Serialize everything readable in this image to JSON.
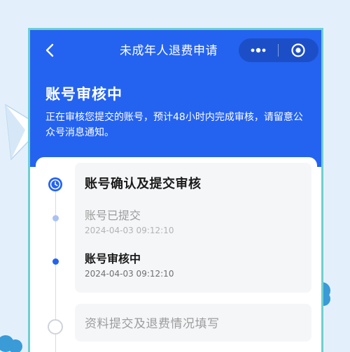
{
  "nav": {
    "title": "未成年人退费申请",
    "back_icon": "chevron-left-icon",
    "more_icon": "more-dots-icon",
    "close_icon": "target-circle-icon"
  },
  "header": {
    "title": "账号审核中",
    "description": "正在审核您提交的账号，预计48小时内完成审核，请留意公众号消息通知。"
  },
  "steps": [
    {
      "title": "账号确认及提交审核",
      "icon": "clock-icon",
      "substeps": [
        {
          "label": "账号已提交",
          "time": "2024-04-03 09:12:10"
        },
        {
          "label": "账号审核中",
          "time": "2024-04-03 09:12:10"
        }
      ]
    },
    {
      "title": "资料提交及退费情况填写"
    }
  ],
  "colors": {
    "primary": "#2463f0",
    "frame": "#6ed0cf",
    "background": "#e3f0fb"
  }
}
